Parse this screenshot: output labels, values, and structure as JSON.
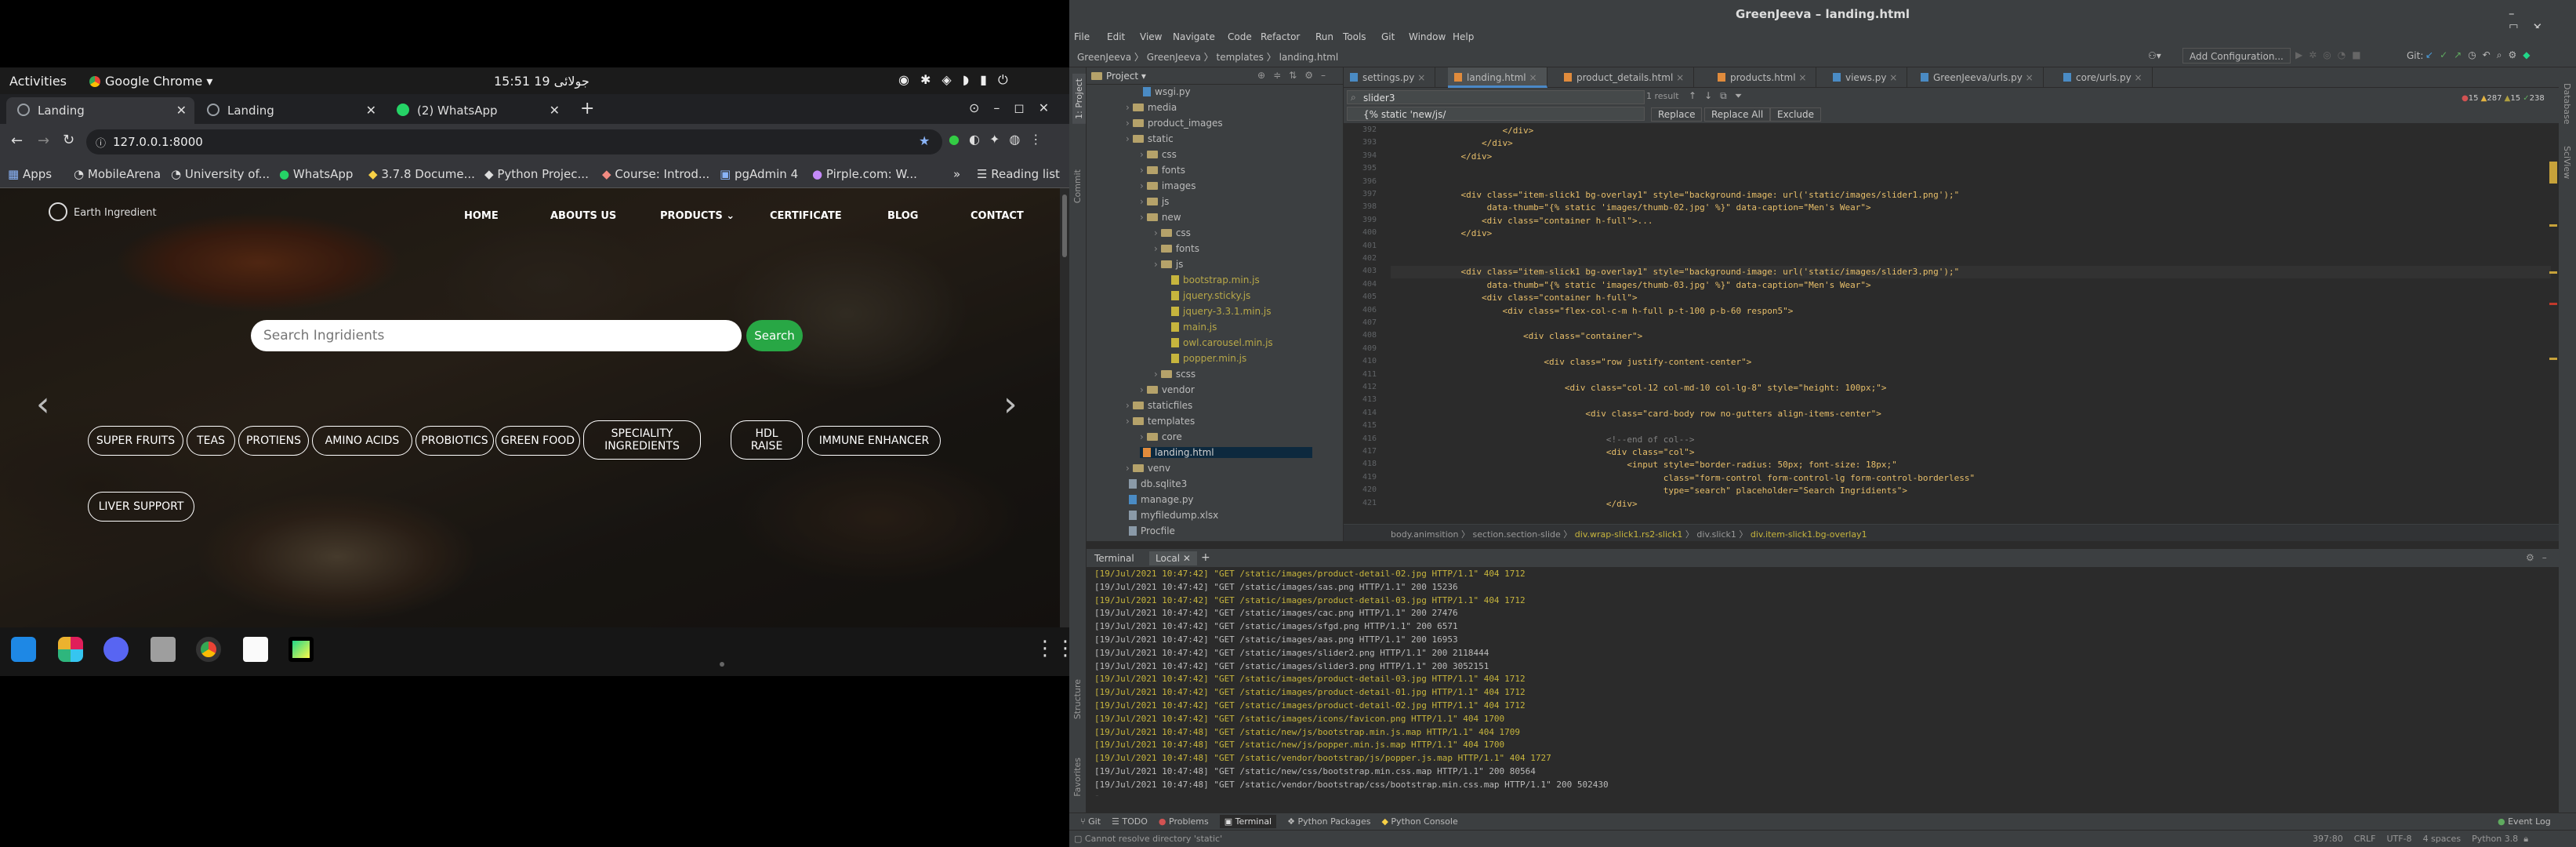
{
  "gnome": {
    "activities": "Activities",
    "app": "Google Chrome",
    "clock": "15:51  19 جولائی"
  },
  "chrome": {
    "tabs": [
      {
        "label": "Landing"
      },
      {
        "label": "Landing"
      },
      {
        "label": "(2) WhatsApp"
      }
    ],
    "new_tab": "+",
    "url": "127.0.0.1:8000",
    "bookmarks": [
      "Apps",
      "MobileArena",
      "University of...",
      "WhatsApp",
      "3.7.8 Docume...",
      "Python Projec...",
      "Course: Introd...",
      "pgAdmin 4",
      "Pirple.com: W..."
    ],
    "bookmarks_more": "»",
    "reading_list": "Reading list"
  },
  "site": {
    "logo": "Earth Ingredient",
    "nav": [
      "HOME",
      "ABOUTS US",
      "PRODUCTS",
      "CERTIFICATE",
      "BLOG",
      "CONTACT"
    ],
    "search_placeholder": "Search Ingridients",
    "search_button": "Search",
    "categories": [
      "SUPER FRUITS",
      "TEAS",
      "PROTIENS",
      "AMINO ACIDS",
      "PROBIOTICS",
      "GREEN FOOD",
      "SPECIALITY INGREDIENTS",
      "HDL RAISE",
      "IMMUNE ENHANCER",
      "LIVER SUPPORT"
    ],
    "prev": "‹",
    "next": "›"
  },
  "ide": {
    "title": "GreenJeeva – landing.html",
    "menu": [
      "File",
      "Edit",
      "View",
      "Navigate",
      "Code",
      "Refactor",
      "Run",
      "Tools",
      "Git",
      "Window",
      "Help"
    ],
    "breadcrumb": [
      "GreenJeeva",
      "GreenJeeva",
      "templates",
      "landing.html"
    ],
    "add_config": "Add Configuration...",
    "git_label": "Git:",
    "project_label": "Project",
    "tree": [
      {
        "name": "wsgi.py",
        "depth": 3,
        "type": "file"
      },
      {
        "name": "media",
        "depth": 2,
        "type": "folder"
      },
      {
        "name": "product_images",
        "depth": 2,
        "type": "folder"
      },
      {
        "name": "static",
        "depth": 2,
        "type": "folder"
      },
      {
        "name": "css",
        "depth": 3,
        "type": "folder"
      },
      {
        "name": "fonts",
        "depth": 3,
        "type": "folder"
      },
      {
        "name": "images",
        "depth": 3,
        "type": "folder"
      },
      {
        "name": "js",
        "depth": 3,
        "type": "folder"
      },
      {
        "name": "new",
        "depth": 3,
        "type": "folder"
      },
      {
        "name": "css",
        "depth": 4,
        "type": "folder"
      },
      {
        "name": "fonts",
        "depth": 4,
        "type": "folder"
      },
      {
        "name": "js",
        "depth": 4,
        "type": "folder"
      },
      {
        "name": "bootstrap.min.js",
        "depth": 5,
        "type": "file"
      },
      {
        "name": "jquery.sticky.js",
        "depth": 5,
        "type": "file"
      },
      {
        "name": "jquery-3.3.1.min.js",
        "depth": 5,
        "type": "file"
      },
      {
        "name": "main.js",
        "depth": 5,
        "type": "file"
      },
      {
        "name": "owl.carousel.min.js",
        "depth": 5,
        "type": "file"
      },
      {
        "name": "popper.min.js",
        "depth": 5,
        "type": "file"
      },
      {
        "name": "scss",
        "depth": 4,
        "type": "folder"
      },
      {
        "name": "vendor",
        "depth": 3,
        "type": "folder"
      },
      {
        "name": "staticfiles",
        "depth": 2,
        "type": "folder"
      },
      {
        "name": "templates",
        "depth": 2,
        "type": "folder"
      },
      {
        "name": "core",
        "depth": 3,
        "type": "folder"
      },
      {
        "name": "landing.html",
        "depth": 3,
        "type": "file"
      },
      {
        "name": "venv",
        "depth": 2,
        "type": "folder"
      },
      {
        "name": "db.sqlite3",
        "depth": 2,
        "type": "file"
      },
      {
        "name": "manage.py",
        "depth": 2,
        "type": "file"
      },
      {
        "name": "myfiledump.xlsx",
        "depth": 2,
        "type": "file"
      },
      {
        "name": "Procfile",
        "depth": 2,
        "type": "file"
      }
    ],
    "editor_tabs": [
      "settings.py",
      "landing.html",
      "product_details.html",
      "products.html",
      "views.py",
      "GreenJeeva/urls.py",
      "core/urls.py"
    ],
    "find": {
      "query": "slider3",
      "replace": "{% static 'new/js/",
      "results": "1 result",
      "replace_btn": "Replace",
      "replace_all": "Replace All",
      "exclude": "Exclude"
    },
    "inspections": {
      "errors": "15",
      "warnings": "287",
      "weak": "15",
      "typos": "238"
    },
    "code_lines": [
      {
        "n": "392",
        "t": "                    </div>"
      },
      {
        "n": "393",
        "t": "                </div>"
      },
      {
        "n": "394",
        "t": "            </div>"
      },
      {
        "n": "395",
        "t": ""
      },
      {
        "n": "396",
        "t": ""
      },
      {
        "n": "397",
        "t": "            <div class=\"item-slick1 bg-overlay1\" style=\"background-image: url('static/images/slider1.png');\""
      },
      {
        "n": "398",
        "t": "                 data-thumb=\"{% static 'images/thumb-02.jpg' %}\" data-caption=\"Men's Wear\">"
      },
      {
        "n": "399",
        "t": "                <div class=\"container h-full\">..."
      },
      {
        "n": "400",
        "t": "            </div>"
      },
      {
        "n": "401",
        "t": ""
      },
      {
        "n": "402",
        "t": ""
      },
      {
        "n": "403",
        "t": "            <div class=\"item-slick1 bg-overlay1\" style=\"background-image: url('static/images/slider3.png');\""
      },
      {
        "n": "404",
        "t": "                 data-thumb=\"{% static 'images/thumb-03.jpg' %}\" data-caption=\"Men's Wear\">"
      },
      {
        "n": "405",
        "t": "                <div class=\"container h-full\">"
      },
      {
        "n": "406",
        "t": "                    <div class=\"flex-col-c-m h-full p-t-100 p-b-60 respon5\">"
      },
      {
        "n": "407",
        "t": ""
      },
      {
        "n": "408",
        "t": "                        <div class=\"container\">"
      },
      {
        "n": "409",
        "t": ""
      },
      {
        "n": "410",
        "t": "                            <div class=\"row justify-content-center\">"
      },
      {
        "n": "411",
        "t": ""
      },
      {
        "n": "412",
        "t": "                                <div class=\"col-12 col-md-10 col-lg-8\" style=\"height: 100px;\">"
      },
      {
        "n": "413",
        "t": ""
      },
      {
        "n": "414",
        "t": "                                    <div class=\"card-body row no-gutters align-items-center\">"
      },
      {
        "n": "415",
        "t": ""
      },
      {
        "n": "416",
        "t": "                                        <!--end of col-->"
      },
      {
        "n": "417",
        "t": "                                        <div class=\"col\">"
      },
      {
        "n": "418",
        "t": "                                            <input style=\"border-radius: 50px; font-size: 18px;\""
      },
      {
        "n": "419",
        "t": "                                                   class=\"form-control form-control-lg form-control-borderless\""
      },
      {
        "n": "420",
        "t": "                                                   type=\"search\" placeholder=\"Search Ingridients\">"
      },
      {
        "n": "421",
        "t": "                                        </div>"
      }
    ],
    "editor_breadcrumb": [
      "body.animsition",
      "section.section-slide",
      "div.wrap-slick1.rs2-slick1",
      "div.slick1",
      "div.item-slick1.bg-overlay1"
    ],
    "terminal_tabs": [
      "Terminal",
      "Local"
    ],
    "terminal_lines": [
      {
        "t": "[19/Jul/2021 10:47:42] \"GET /static/images/product-detail-02.jpg HTTP/1.1\" 404 1712",
        "warn": true
      },
      {
        "t": "[19/Jul/2021 10:47:42] \"GET /static/images/sas.png HTTP/1.1\" 200 15236",
        "warn": false
      },
      {
        "t": "[19/Jul/2021 10:47:42] \"GET /static/images/product-detail-03.jpg HTTP/1.1\" 404 1712",
        "warn": true
      },
      {
        "t": "[19/Jul/2021 10:47:42] \"GET /static/images/cac.png HTTP/1.1\" 200 27476",
        "warn": false
      },
      {
        "t": "[19/Jul/2021 10:47:42] \"GET /static/images/sfgd.png HTTP/1.1\" 200 6571",
        "warn": false
      },
      {
        "t": "[19/Jul/2021 10:47:42] \"GET /static/images/aas.png HTTP/1.1\" 200 16953",
        "warn": false
      },
      {
        "t": "[19/Jul/2021 10:47:42] \"GET /static/images/slider2.png HTTP/1.1\" 200 2118444",
        "warn": false
      },
      {
        "t": "[19/Jul/2021 10:47:42] \"GET /static/images/slider3.png HTTP/1.1\" 200 3052151",
        "warn": false
      },
      {
        "t": "[19/Jul/2021 10:47:42] \"GET /static/images/product-detail-03.jpg HTTP/1.1\" 404 1712",
        "warn": true
      },
      {
        "t": "[19/Jul/2021 10:47:42] \"GET /static/images/product-detail-01.jpg HTTP/1.1\" 404 1712",
        "warn": true
      },
      {
        "t": "[19/Jul/2021 10:47:42] \"GET /static/images/product-detail-02.jpg HTTP/1.1\" 404 1712",
        "warn": true
      },
      {
        "t": "[19/Jul/2021 10:47:42] \"GET /static/images/icons/favicon.png HTTP/1.1\" 404 1700",
        "warn": true
      },
      {
        "t": "[19/Jul/2021 10:47:48] \"GET /static/new/js/bootstrap.min.js.map HTTP/1.1\" 404 1709",
        "warn": true
      },
      {
        "t": "[19/Jul/2021 10:47:48] \"GET /static/new/js/popper.min.js.map HTTP/1.1\" 404 1700",
        "warn": true
      },
      {
        "t": "[19/Jul/2021 10:47:48] \"GET /static/vendor/bootstrap/js/popper.js.map HTTP/1.1\" 404 1727",
        "warn": true
      },
      {
        "t": "[19/Jul/2021 10:47:48] \"GET /static/new/css/bootstrap.min.css.map HTTP/1.1\" 200 80564",
        "warn": false
      },
      {
        "t": "[19/Jul/2021 10:47:48] \"GET /static/vendor/bootstrap/css/bootstrap.min.css.map HTTP/1.1\" 200 502430",
        "warn": false
      }
    ],
    "bottom_tools": [
      "Git",
      "TODO",
      "Problems",
      "Terminal",
      "Python Packages",
      "Python Console"
    ],
    "event_log": "Event Log",
    "status_msg": "Cannot resolve directory 'static'",
    "status_right": [
      "397:80",
      "CRLF",
      "UTF-8",
      "4 spaces",
      "Python 3.8"
    ]
  },
  "colors": {
    "accent_green": "#28a745",
    "tag": "#e8bf6a",
    "attr": "#bababa",
    "string": "#6a8759",
    "warn": "#c7b53d"
  }
}
